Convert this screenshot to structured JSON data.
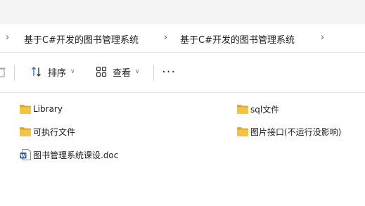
{
  "breadcrumb": {
    "items": [
      {
        "label": "基于C#开发的图书管理系统"
      },
      {
        "label": "基于C#开发的图书管理系统"
      }
    ]
  },
  "toolbar": {
    "sort_label": "排序",
    "view_label": "查看",
    "more_label": "..."
  },
  "files": [
    {
      "name": "Library",
      "type": "folder-icon"
    },
    {
      "name": "sql文件",
      "type": "folder-icon"
    },
    {
      "name": "可执行文件",
      "type": "folder-icon"
    },
    {
      "name": "图片接口(不运行没影响)",
      "type": "folder-icon"
    },
    {
      "name": "图书管理系统课设.doc",
      "type": "word-document-icon"
    }
  ],
  "colors": {
    "folder": "#f5c342",
    "folder_dark": "#e0a82a",
    "word_blue": "#2b579a",
    "sort_icon_blue": "#2a6fd1"
  }
}
